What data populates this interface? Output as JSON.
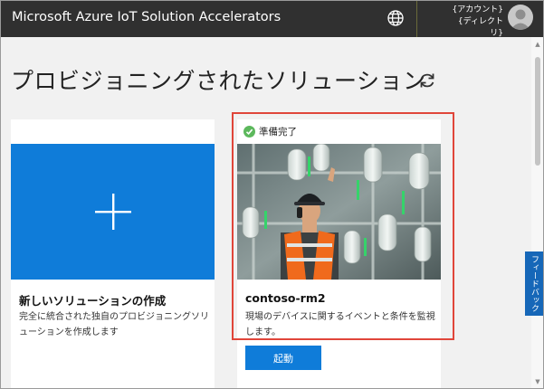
{
  "header": {
    "app_title": "Microsoft Azure IoT Solution Accelerators",
    "globe_icon": "globe-icon",
    "account_line1": "{アカウント}",
    "account_line2": "{ディレクトリ}",
    "avatar_icon": "user-avatar-icon"
  },
  "page": {
    "title": "プロビジョニングされたソリューション",
    "refresh_icon": "refresh-icon"
  },
  "new_solution_card": {
    "icon": "plus-icon",
    "title": "新しいソリューションの作成",
    "description": "完全に統合された独自のプロビジョニングソリューションを作成します"
  },
  "solution_card": {
    "status_icon": "check-circle-icon",
    "status": "準備完了",
    "image": "worker-in-factory-image",
    "name": "contoso-rm2",
    "description": "現場のデバイスに関するイベントと条件を監視します。",
    "launch_label": "起動"
  },
  "feedback": {
    "label": "フィードバック"
  },
  "colors": {
    "topbar": "#303030",
    "accent_blue": "#0f7cd9",
    "highlight_red": "#e0463a",
    "ready_green": "#5cb85c"
  }
}
